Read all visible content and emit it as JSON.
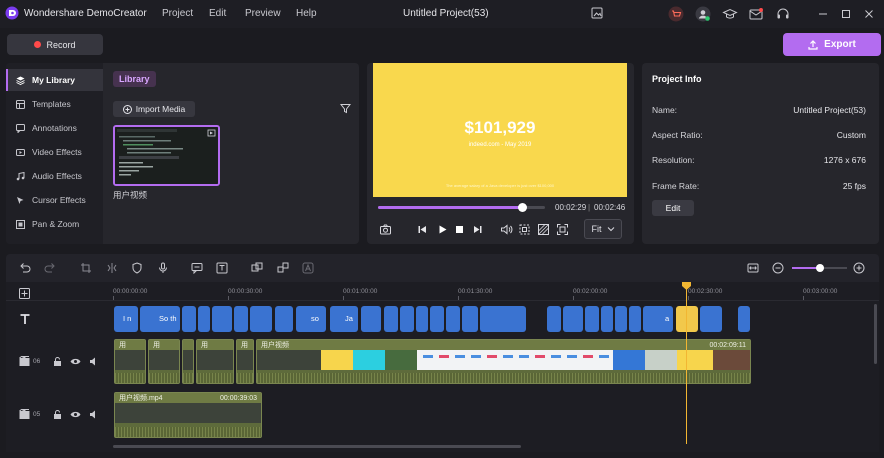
{
  "app": {
    "name": "Wondershare DemoCreator",
    "menu": [
      "Project",
      "Edit",
      "Preview",
      "Help"
    ],
    "project_title": "Untitled Project(53)",
    "icons": [
      "screenshot-icon",
      "cart-icon",
      "account-icon",
      "graduation-icon",
      "mail-icon",
      "support-icon",
      "minimize-icon",
      "maximize-icon",
      "close-icon"
    ],
    "accent": "#b36cf0"
  },
  "toolbar": {
    "record_label": "Record",
    "export_label": "Export"
  },
  "sidebar": {
    "items": [
      {
        "label": "My Library",
        "icon": "layers-icon",
        "active": true
      },
      {
        "label": "Templates",
        "icon": "template-icon"
      },
      {
        "label": "Annotations",
        "icon": "annotation-icon"
      },
      {
        "label": "Video Effects",
        "icon": "video-effects-icon"
      },
      {
        "label": "Audio Effects",
        "icon": "audio-effects-icon"
      },
      {
        "label": "Cursor Effects",
        "icon": "cursor-icon"
      },
      {
        "label": "Pan & Zoom",
        "icon": "pan-zoom-icon"
      }
    ]
  },
  "library": {
    "title": "Library",
    "import_label": "Import Media",
    "media_label": "用户视频"
  },
  "preview": {
    "price": "$101,929",
    "subtitle": "indeed.com - May 2019",
    "note": "The average salary of a Java developer is just over $100,000",
    "current_time": "00:02:29",
    "separator": "|",
    "total_time": "00:02:46",
    "progress": 0.86,
    "fit_label": "Fit"
  },
  "project_info": {
    "title": "Project Info",
    "rows": [
      {
        "key": "Name:",
        "value": "Untitled Project(53)"
      },
      {
        "key": "Aspect Ratio:",
        "value": "Custom"
      },
      {
        "key": "Resolution:",
        "value": "1276 x 676"
      },
      {
        "key": "Frame Rate:",
        "value": "25 fps"
      }
    ],
    "edit_label": "Edit"
  },
  "timeline": {
    "ruler": [
      "00:00:00:00",
      "00:00:30:00",
      "00:01:00:00",
      "00:01:30:00",
      "00:02:00:00",
      "00:02:30:00",
      "00:03:00:00"
    ],
    "captions": [
      "I n",
      "So th",
      "so",
      "Ja",
      "a"
    ],
    "track_06": {
      "number": "06",
      "clip_label": "用户视频",
      "clip_time": "00:02:09:11"
    },
    "track_05": {
      "number": "05",
      "clip_label": "用户视频.mp4",
      "clip_time": "00:00:39:03"
    },
    "small_clip_label": "用"
  }
}
